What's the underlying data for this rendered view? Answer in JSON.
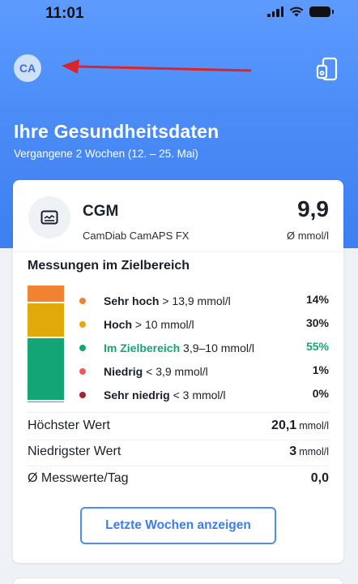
{
  "status_bar": {
    "time": "11:01"
  },
  "header": {
    "avatar_initials": "CA",
    "title": "Ihre Gesundheitsdaten",
    "subtitle": "Vergangene 2 Wochen (12. – 25. Mai)"
  },
  "cgm_card": {
    "title": "CGM",
    "device": "CamDiab CamAPS FX",
    "value": "9,9",
    "unit": "Ø mmol/l",
    "section_title": "Messungen im Zielbereich",
    "ranges": [
      {
        "name": "Sehr hoch",
        "threshold": " > 13,9 mmol/l",
        "percent": "14%",
        "fraction": 0.14,
        "color": "#f08232"
      },
      {
        "name": "Hoch",
        "threshold": " > 10 mmol/l",
        "percent": "30%",
        "fraction": 0.3,
        "color": "#e1a90a"
      },
      {
        "name": "Im Zielbereich",
        "threshold": " 3,9–10 mmol/l",
        "percent": "55%",
        "fraction": 0.55,
        "color": "#14a577"
      },
      {
        "name": "Niedrig",
        "threshold": " < 3,9 mmol/l",
        "percent": "1%",
        "fraction": 0.01,
        "color": "#f05a5a"
      },
      {
        "name": "Sehr niedrig",
        "threshold": " < 3 mmol/l",
        "percent": "0%",
        "fraction": 0.0,
        "color": "#a3242c"
      }
    ],
    "stats": [
      {
        "label": "Höchster Wert",
        "value": "20,1",
        "unit": "mmol/l"
      },
      {
        "label": "Niedrigster Wert",
        "value": "3",
        "unit": "mmol/l"
      },
      {
        "label": "Ø Messwerte/Tag",
        "value": "0,0",
        "unit": ""
      }
    ],
    "button_label": "Letzte Wochen anzeigen"
  },
  "colors": {
    "header_gradient_top": "#5d9bff",
    "accent_blue": "#3c7df0",
    "target_green": "#14a577",
    "annotation_arrow": "#d9252a"
  },
  "icons": [
    "avatar",
    "annotation-arrow",
    "share-device-icon",
    "cgm-sensor-icon"
  ]
}
